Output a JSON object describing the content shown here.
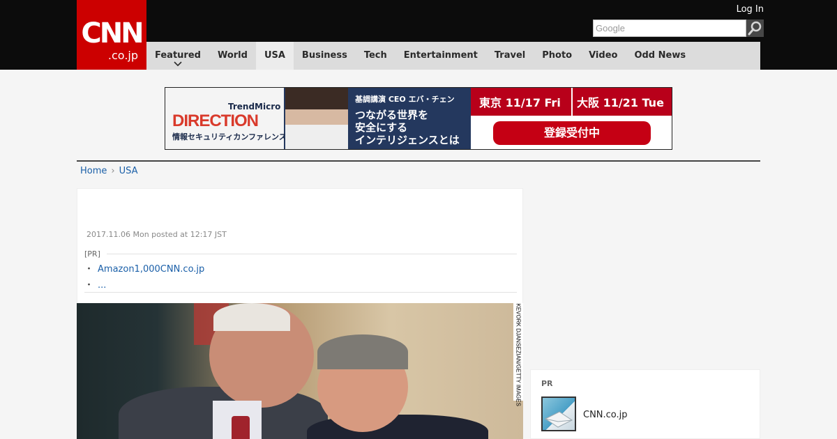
{
  "header": {
    "logo_main": "CNN",
    "logo_sub": ".co.jp",
    "login_label": "Log In",
    "search_placeholder": "Google",
    "search_button_icon": "search-icon"
  },
  "nav": {
    "items": [
      {
        "label": "Featured",
        "has_dropdown": true
      },
      {
        "label": "World"
      },
      {
        "label": "USA",
        "active": true
      },
      {
        "label": "Business"
      },
      {
        "label": "Tech"
      },
      {
        "label": "Entertainment"
      },
      {
        "label": "Travel"
      },
      {
        "label": "Photo"
      },
      {
        "label": "Video"
      },
      {
        "label": "Odd News"
      }
    ],
    "dropdown_icon": "chevron-down-icon"
  },
  "banner_ad": {
    "brand_top": "TrendMicro",
    "brand_main": "DIRECTION",
    "brand_sub": "情報セキュリティカンファレンス",
    "speaker": "基調講演 CEO エバ・チェン",
    "headline_1": "つながる世界を",
    "headline_2": "安全にする",
    "headline_3": "インテリジェンスとは",
    "date_tokyo": "東京 11/17 Fri",
    "date_osaka": "大阪 11/21 Tue",
    "register_label": "登録受付中"
  },
  "breadcrumb": {
    "home": "Home",
    "current": "USA",
    "separator": "›"
  },
  "article": {
    "posted": "2017.11.06 Mon posted at 12:17 JST",
    "pr_label": "[PR]",
    "pr_links": [
      {
        "bullet": "・",
        "text": "Amazon1,000CNN.co.jp"
      },
      {
        "bullet": "・",
        "text": "..."
      }
    ],
    "photo_credit": "KEVORK DJANSEZIAN/GETTY IMAGES"
  },
  "sidebar_pr": {
    "label": "PR",
    "item_title": "CNN.co.jp",
    "thumb_icon": "mail-thumbnail-icon"
  },
  "colors": {
    "brand_red": "#cc0000",
    "top_bar": "#0c0c0c",
    "nav_bg": "#dcdcdc",
    "link_blue": "#1a5fa8"
  }
}
